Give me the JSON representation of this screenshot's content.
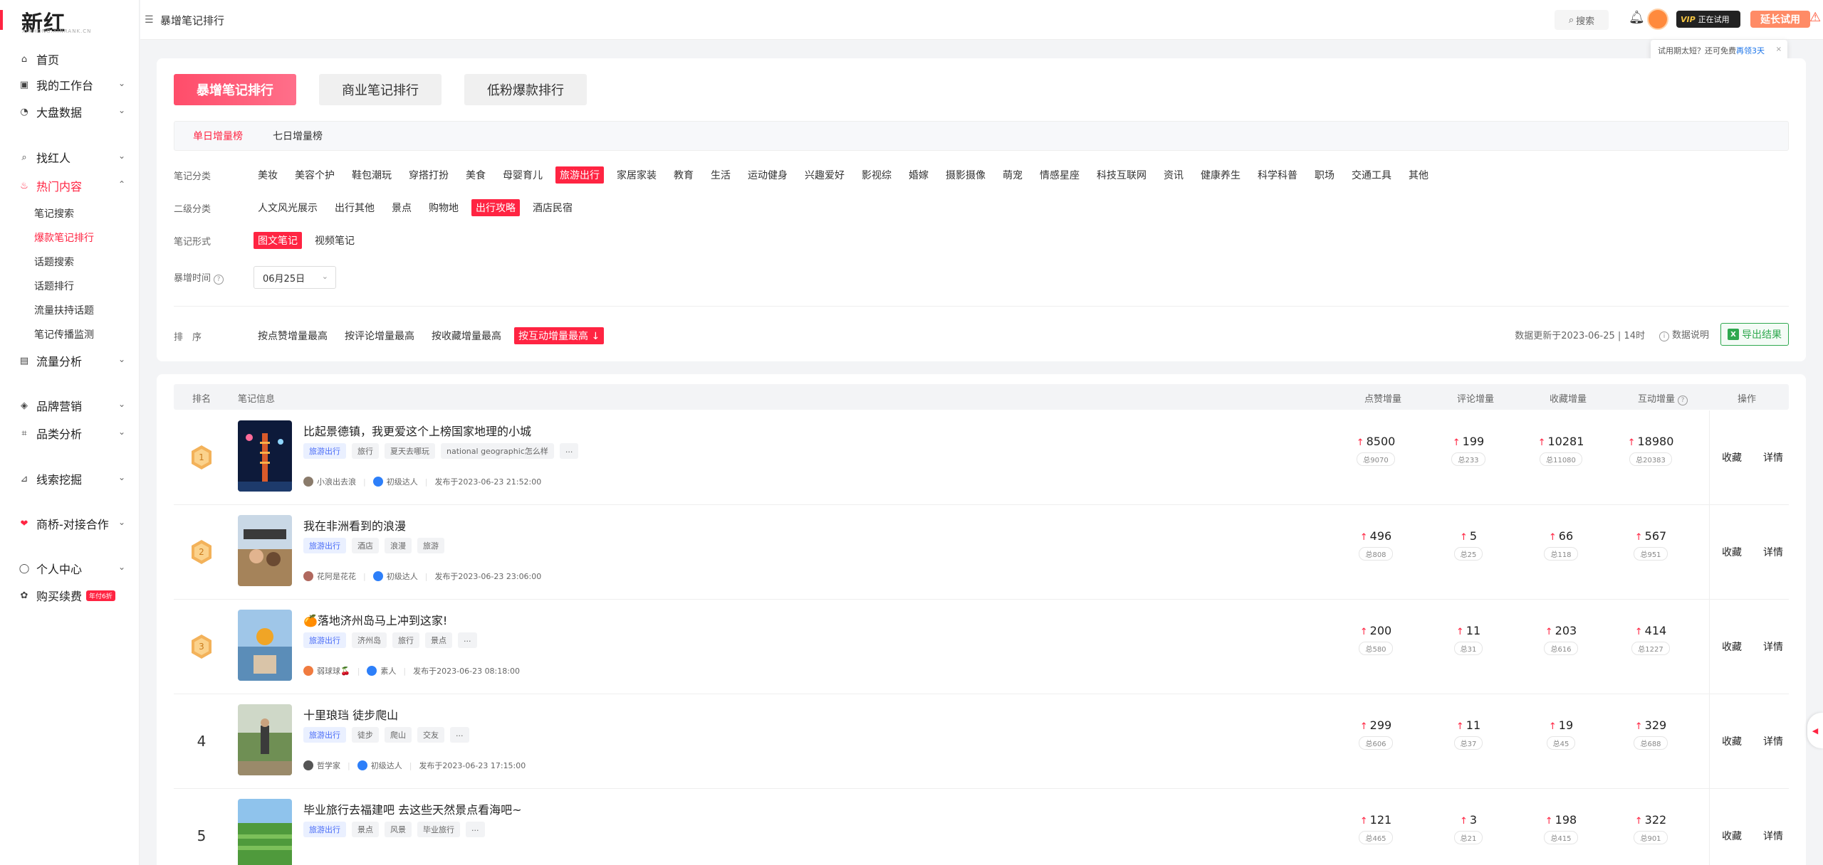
{
  "app": {
    "logo": "新红",
    "logo_sub": "XINHONG.XINRANK.CN"
  },
  "topbar": {
    "title": "暴增笔记排行",
    "search_label": "搜索",
    "vip_brand": "VIP",
    "vip_status": "正在试用",
    "extend_label": "延长试用",
    "trial_tip_prefix": "试用期太短？还可免费",
    "trial_tip_link": "再领3天",
    "trial_tip_close": "×"
  },
  "sidebar": {
    "items": [
      {
        "label": "首页",
        "icon": "home-icon"
      },
      {
        "label": "我的工作台",
        "icon": "workbench-icon"
      },
      {
        "label": "大盘数据",
        "icon": "dashboard-icon"
      },
      {
        "label": "找红人",
        "icon": "search-person-icon"
      },
      {
        "label": "热门内容",
        "icon": "fire-icon"
      },
      {
        "label": "流量分析",
        "icon": "chart-icon"
      },
      {
        "label": "品牌营销",
        "icon": "megaphone-icon"
      },
      {
        "label": "品类分析",
        "icon": "tag-icon"
      },
      {
        "label": "线索挖掘",
        "icon": "clue-icon"
      },
      {
        "label": "商桥-对接合作",
        "icon": "handshake-icon"
      },
      {
        "label": "个人中心",
        "icon": "user-icon"
      },
      {
        "label": "购买续费",
        "icon": "gift-icon"
      }
    ],
    "sub_items": [
      "笔记搜索",
      "爆款笔记排行",
      "话题搜索",
      "话题排行",
      "流量扶持话题",
      "笔记传播监测"
    ],
    "pay_badge": "年付6折"
  },
  "tabs": [
    "暴增笔记排行",
    "商业笔记排行",
    "低粉爆款排行"
  ],
  "subtabs": [
    "单日增量榜",
    "七日增量榜"
  ],
  "filters": {
    "category_label": "笔记分类",
    "categories": [
      "美妆",
      "美容个护",
      "鞋包潮玩",
      "穿搭打扮",
      "美食",
      "母婴育儿",
      "旅游出行",
      "家居家装",
      "教育",
      "生活",
      "运动健身",
      "兴趣爱好",
      "影视综",
      "婚嫁",
      "摄影摄像",
      "萌宠",
      "情感星座",
      "科技互联网",
      "资讯",
      "健康养生",
      "科学科普",
      "职场",
      "交通工具",
      "其他"
    ],
    "sub_label": "二级分类",
    "subcategories": [
      "人文风光展示",
      "出行其他",
      "景点",
      "购物地",
      "出行攻略",
      "酒店民宿"
    ],
    "form_label": "笔记形式",
    "forms": [
      "图文笔记",
      "视频笔记"
    ],
    "time_label": "暴增时间",
    "time_value": "06月25日",
    "sort_label": "排　序",
    "sorts": [
      "按点赞增量最高",
      "按评论增量最高",
      "按收藏增量最高",
      "按互动增量最高"
    ],
    "update_text": "数据更新于2023-06-25 | 14时",
    "data_desc": "数据说明",
    "export_label": "导出结果"
  },
  "table": {
    "headers": [
      "排名",
      "笔记信息",
      "点赞增量",
      "评论增量",
      "收藏增量",
      "互动增量",
      "操作"
    ],
    "op_collect": "收藏",
    "op_detail": "详情",
    "rows": [
      {
        "rank": "1",
        "title": "比起景德镇，我更爱这个上榜国家地理的小城",
        "tags": [
          "旅游出行",
          "旅行",
          "夏天去哪玩",
          "national geographic怎么样",
          "..."
        ],
        "author": "小浪出去浪",
        "level": "初级达人",
        "pub": "发布于2023-06-23 21:52:00",
        "likes": "8500",
        "likes_total": "总9070",
        "comments": "199",
        "comments_total": "总233",
        "collects": "10281",
        "collects_total": "总11080",
        "inter": "18980",
        "inter_total": "总20383"
      },
      {
        "rank": "2",
        "title": "我在非洲看到的浪漫",
        "tags": [
          "旅游出行",
          "酒店",
          "浪漫",
          "旅游"
        ],
        "author": "花阿是花花",
        "level": "初级达人",
        "pub": "发布于2023-06-23 23:06:00",
        "likes": "496",
        "likes_total": "总808",
        "comments": "5",
        "comments_total": "总25",
        "collects": "66",
        "collects_total": "总118",
        "inter": "567",
        "inter_total": "总951"
      },
      {
        "rank": "3",
        "title": "🍊落地济州岛马上冲到这家!",
        "tags": [
          "旅游出行",
          "济州岛",
          "旅行",
          "景点",
          "..."
        ],
        "author": "弱球球🍒",
        "level": "素人",
        "pub": "发布于2023-06-23 08:18:00",
        "likes": "200",
        "likes_total": "总580",
        "comments": "11",
        "comments_total": "总31",
        "collects": "203",
        "collects_total": "总616",
        "inter": "414",
        "inter_total": "总1227"
      },
      {
        "rank": "4",
        "title": "十里琅珰 徒步爬山",
        "tags": [
          "旅游出行",
          "徒步",
          "爬山",
          "交友",
          "..."
        ],
        "author": "哲学家",
        "level": "初级达人",
        "pub": "发布于2023-06-23 17:15:00",
        "likes": "299",
        "likes_total": "总606",
        "comments": "11",
        "comments_total": "总37",
        "collects": "19",
        "collects_total": "总45",
        "inter": "329",
        "inter_total": "总688"
      },
      {
        "rank": "5",
        "title": "毕业旅行去福建吧 去这些天然景点看海吧~",
        "tags": [
          "旅游出行",
          "景点",
          "风景",
          "毕业旅行",
          "..."
        ],
        "author": "",
        "level": "",
        "pub": "",
        "likes": "121",
        "likes_total": "总465",
        "comments": "3",
        "comments_total": "总21",
        "collects": "198",
        "collects_total": "总415",
        "inter": "322",
        "inter_total": "总901"
      }
    ]
  }
}
